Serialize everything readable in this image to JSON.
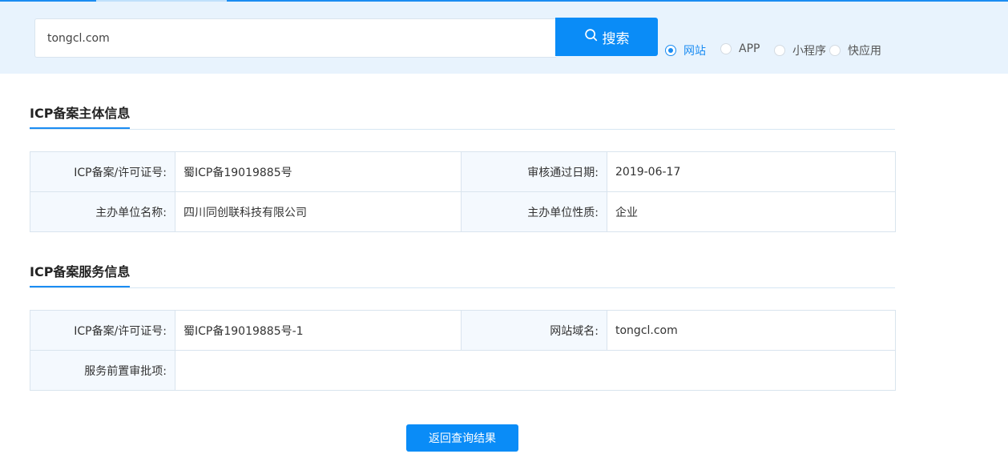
{
  "search": {
    "value": "tongcl.com",
    "button_label": "搜索",
    "options": [
      {
        "label": "网站",
        "checked": true
      },
      {
        "label": "APP",
        "checked": false
      },
      {
        "label": "小程序",
        "checked": false
      },
      {
        "label": "快应用",
        "checked": false
      }
    ]
  },
  "subject_section": {
    "title": "ICP备案主体信息",
    "rows": [
      [
        {
          "key": "ICP备案/许可证号:",
          "value": "蜀ICP备19019885号"
        },
        {
          "key": "审核通过日期:",
          "value": "2019-06-17"
        }
      ],
      [
        {
          "key": "主办单位名称:",
          "value": "四川同创联科技有限公司"
        },
        {
          "key": "主办单位性质:",
          "value": "企业"
        }
      ]
    ]
  },
  "service_section": {
    "title": "ICP备案服务信息",
    "rows": [
      [
        {
          "key": "ICP备案/许可证号:",
          "value": "蜀ICP备19019885号-1"
        },
        {
          "key": "网站域名:",
          "value": "tongcl.com"
        }
      ],
      [
        {
          "key": "服务前置审批项:",
          "value": ""
        }
      ]
    ]
  },
  "back_button_label": "返回查询结果",
  "colors": {
    "accent": "#1b8cf2",
    "band": "#e8f3fd",
    "key_cell": "#f4f9fe"
  }
}
